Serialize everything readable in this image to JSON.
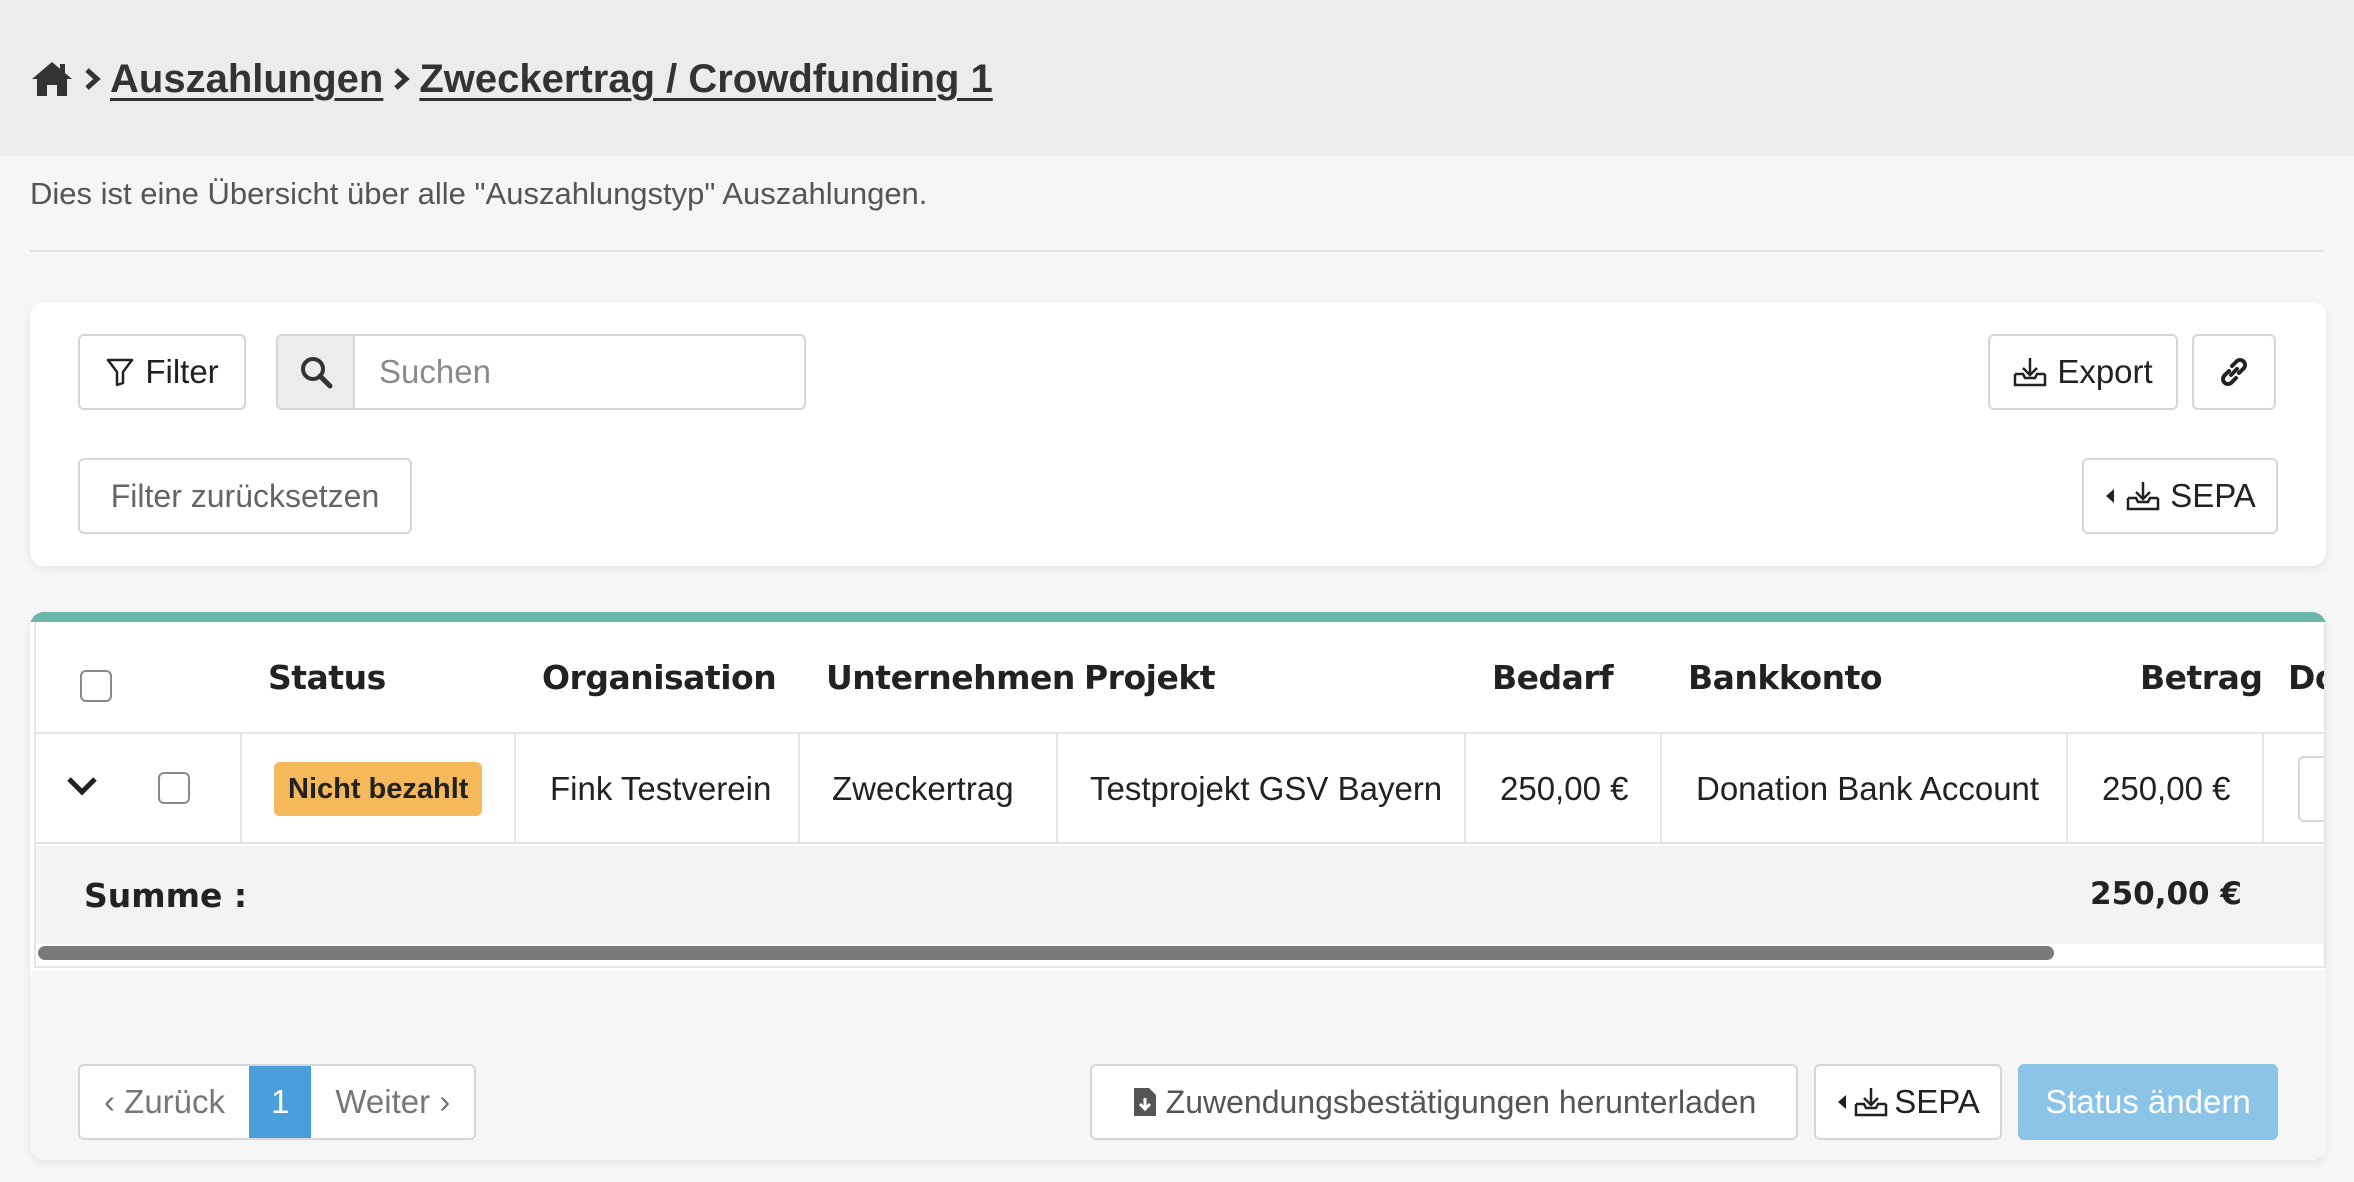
{
  "breadcrumb": {
    "items": [
      "Auszahlungen",
      "Zweckertrag / Crowdfunding 1"
    ]
  },
  "intro_text": "Dies ist eine Übersicht über alle \"Auszahlungstyp\" Auszahlungen.",
  "filters": {
    "filter_label": "Filter",
    "search_placeholder": "Suchen",
    "export_label": "Export",
    "reset_label": "Filter zurücksetzen",
    "sepa_label": "SEPA"
  },
  "table": {
    "headers": [
      "Status",
      "Organisation",
      "Unternehmen",
      "Projekt",
      "Bedarf",
      "Bankkonto",
      "Betrag",
      "Do"
    ],
    "rows": [
      {
        "status": "Nicht bezahlt",
        "organisation": "Fink Testverein",
        "unternehmen": "Zweckertrag",
        "projekt": "Testprojekt GSV Bayern",
        "bedarf": "250,00 €",
        "bankkonto": "Donation Bank Account",
        "betrag": "250,00 €"
      }
    ],
    "sum_label": "Summe :",
    "sum_value": "250,00 €"
  },
  "footer": {
    "prev_label": "‹ Zurück",
    "current_page": "1",
    "next_label": "Weiter ›",
    "download_label": "Zuwendungsbestätigungen herunterladen",
    "sepa_label": "SEPA",
    "status_label": "Status ändern"
  },
  "colors": {
    "accent": "#6ab6ab",
    "badge_warning": "#f5b85a",
    "page_active": "#4a9fdb",
    "primary_disabled": "#8cc4e8"
  }
}
